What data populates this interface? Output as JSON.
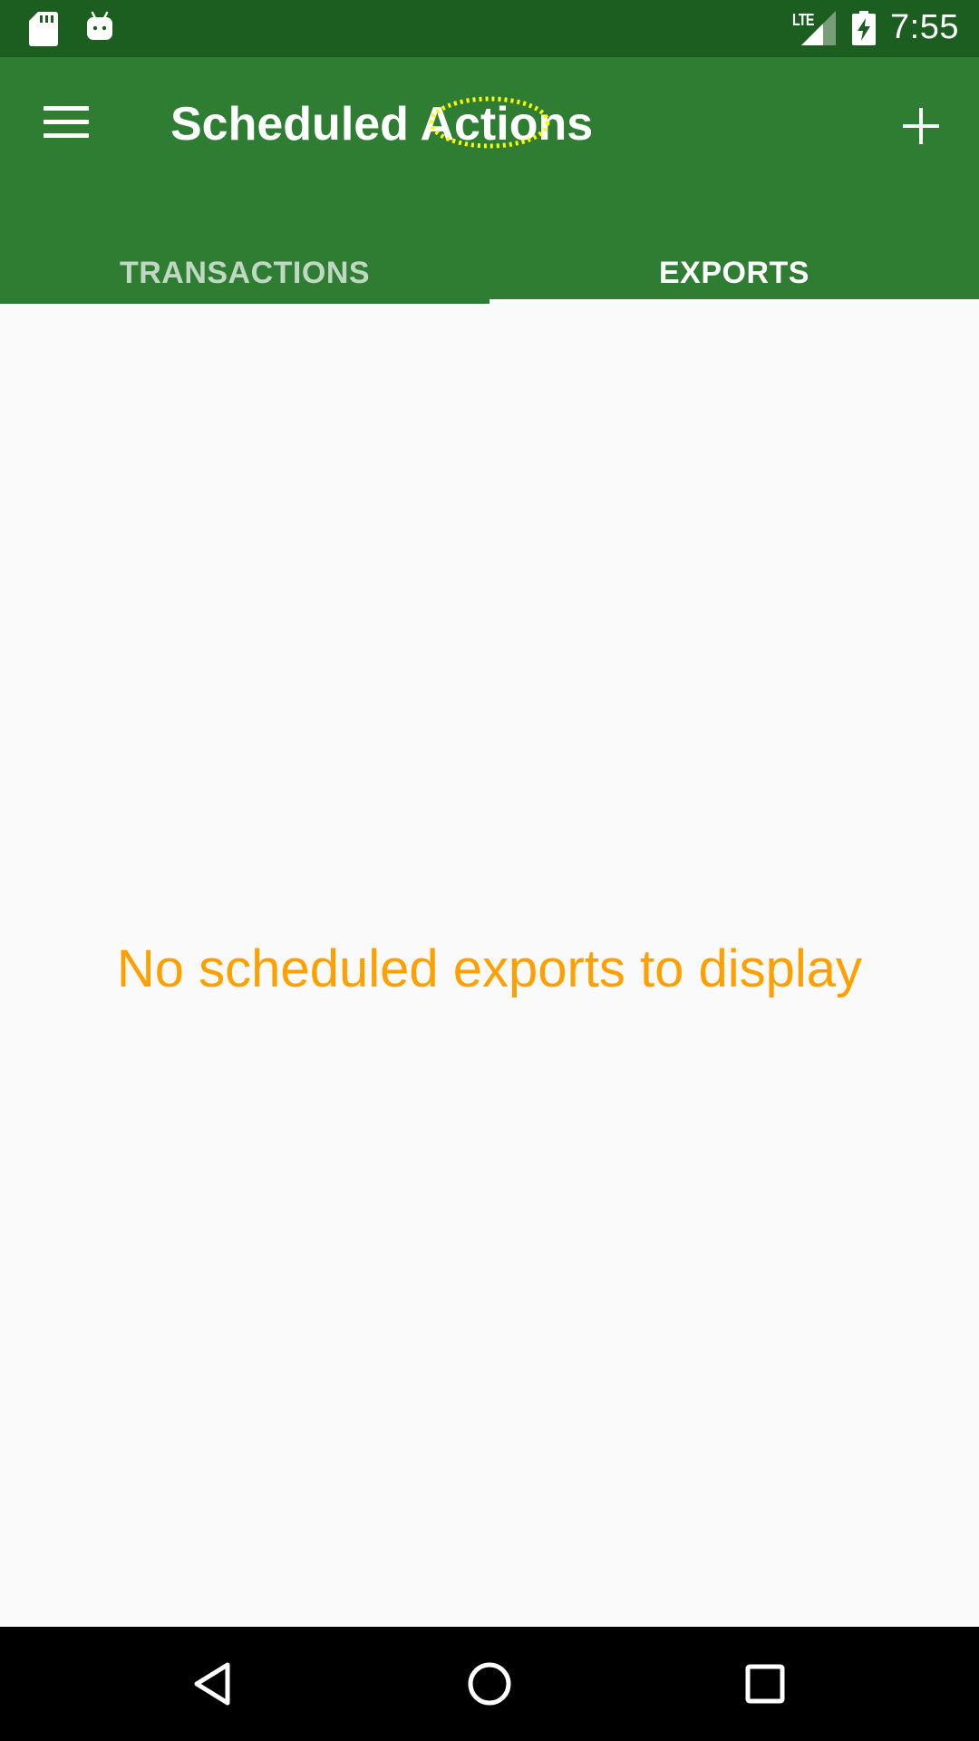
{
  "status_bar": {
    "time": "7:55",
    "network_label": "LTE",
    "icons": [
      "sd-card-icon",
      "android-icon",
      "signal-icon",
      "battery-charging-icon"
    ]
  },
  "app_bar": {
    "title": "Scheduled Actions",
    "menu_icon": "hamburger-menu-icon",
    "add_icon": "plus-icon",
    "background_color": "#2e7d32"
  },
  "tabs": [
    {
      "label": "TRANSACTIONS",
      "selected": false
    },
    {
      "label": "EXPORTS",
      "selected": true
    }
  ],
  "content": {
    "empty_message": "No scheduled exports to display",
    "empty_message_color": "#ffa000"
  },
  "nav_bar": {
    "icons": [
      "back-icon",
      "home-icon",
      "recents-icon"
    ]
  },
  "colors": {
    "status_bar": "#1b5e20",
    "primary": "#2e7d32",
    "accent": "#ffa000"
  }
}
